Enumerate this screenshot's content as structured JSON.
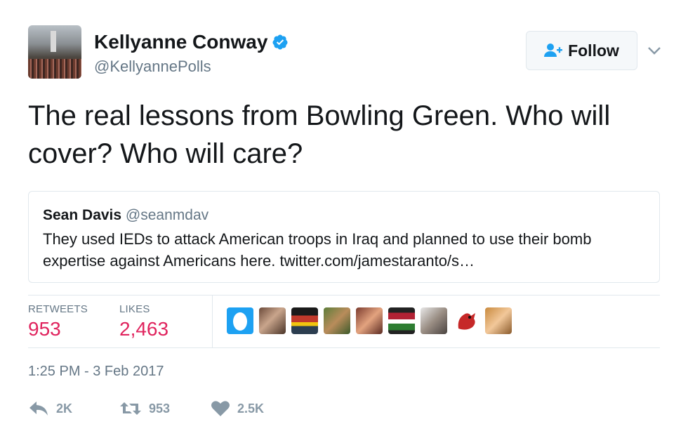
{
  "author": {
    "display_name": "Kellyanne Conway",
    "handle": "@KellyannePolls",
    "verified": true
  },
  "follow_button": {
    "label": "Follow"
  },
  "tweet": {
    "text": "The real lessons from Bowling Green. Who will cover? Who will care?"
  },
  "quoted_tweet": {
    "display_name": "Sean Davis",
    "handle": "@seanmdav",
    "text": "They used IEDs to attack American troops in Iraq and planned to use their bomb expertise against Americans here. twitter.com/jamestaranto/s…"
  },
  "stats": {
    "retweets_label": "RETWEETS",
    "retweets_value": "953",
    "likes_label": "LIKES",
    "likes_value": "2,463"
  },
  "timestamp": "1:25 PM - 3 Feb 2017",
  "actions": {
    "reply_count": "2K",
    "retweet_count": "953",
    "like_count": "2.5K"
  },
  "colors": {
    "accent": "#1da1f2",
    "likes": "#e0245e",
    "muted": "#657786",
    "icon": "#8899a6",
    "border": "#e1e8ed"
  },
  "icons": [
    "verified-badge-icon",
    "follow-person-icon",
    "chevron-down-icon",
    "reply-icon",
    "retweet-icon",
    "heart-icon"
  ]
}
